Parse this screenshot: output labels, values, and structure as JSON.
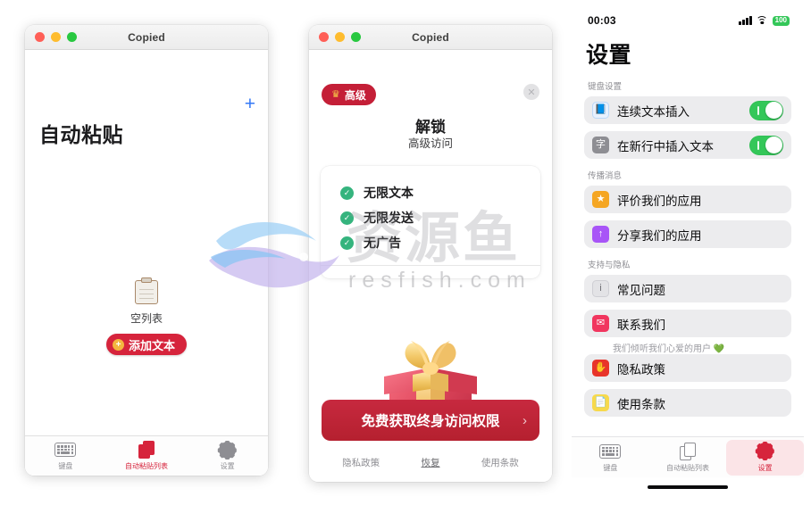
{
  "panel1": {
    "window_title": "Copied",
    "add_icon": "plus-icon",
    "heading": "自动粘贴",
    "empty_label": "空列表",
    "add_button": "添加文本",
    "tabs": [
      {
        "label": "键盘",
        "icon": "keyboard-icon",
        "active": false
      },
      {
        "label": "自动粘贴列表",
        "icon": "documents-icon",
        "active": true
      },
      {
        "label": "设置",
        "icon": "gear-icon",
        "active": false
      }
    ]
  },
  "panel2": {
    "window_title": "Copied",
    "pro_badge": "高级",
    "crown_icon": "crown-icon",
    "close_icon": "close-icon",
    "title": "解锁",
    "subtitle": "高级访问",
    "features": [
      "无限文本",
      "无限发送",
      "无广告"
    ],
    "gift_icon": "gift-box-illustration",
    "cta_label": "免费获取终身访问权限",
    "cta_chevron": "›",
    "footer": [
      {
        "label": "隐私政策",
        "underline": false
      },
      {
        "label": "恢复",
        "underline": true
      },
      {
        "label": "使用条款",
        "underline": false
      }
    ]
  },
  "panel3": {
    "status": {
      "time": "00:03",
      "signal_icon": "cellular-signal-icon",
      "wifi_icon": "wifi-icon",
      "battery": "100"
    },
    "title": "设置",
    "sections": [
      {
        "header": "键盘设置",
        "rows": [
          {
            "label": "连续文本插入",
            "icon": "book-icon",
            "icon_glyph": "📘",
            "icon_class": "ic-blue",
            "toggle": true
          },
          {
            "label": "在新行中插入文本",
            "icon": "text-insert-icon",
            "icon_glyph": "字",
            "icon_class": "ic-gray",
            "toggle": true
          }
        ]
      },
      {
        "header": "传播消息",
        "rows": [
          {
            "label": "评价我们的应用",
            "icon": "star-icon",
            "icon_glyph": "★",
            "icon_class": "ic-orange",
            "toggle": false
          },
          {
            "label": "分享我们的应用",
            "icon": "share-icon",
            "icon_glyph": "↑",
            "icon_class": "ic-purple",
            "toggle": false
          }
        ]
      },
      {
        "header": "支持与隐私",
        "rows": [
          {
            "label": "常见问题",
            "icon": "info-icon",
            "icon_glyph": "i",
            "icon_class": "ic-gray2",
            "toggle": false
          },
          {
            "label": "联系我们",
            "icon": "mail-icon",
            "icon_glyph": "✉",
            "icon_class": "ic-pink",
            "toggle": false,
            "sub": "我们倾听我们心爱的用户 💚"
          },
          {
            "label": "隐私政策",
            "icon": "hand-icon",
            "icon_glyph": "✋",
            "icon_class": "ic-red",
            "toggle": false
          },
          {
            "label": "使用条款",
            "icon": "document-icon",
            "icon_glyph": "📄",
            "icon_class": "ic-yellow",
            "toggle": false
          }
        ]
      }
    ],
    "tabs": [
      {
        "label": "键盘",
        "icon": "keyboard-icon",
        "active": false
      },
      {
        "label": "自动粘贴列表",
        "icon": "documents-icon",
        "active": false
      },
      {
        "label": "设置",
        "icon": "gear-icon",
        "active": true
      }
    ]
  },
  "watermark": {
    "text": "资源鱼",
    "url": "resfish.com",
    "logo_icon": "fish-logo-icon"
  },
  "colors": {
    "accent_red": "#d6243c",
    "cta_red": "#c7293f",
    "toggle_green": "#34c759",
    "check_green": "#35b47e",
    "link_blue": "#3478f6"
  }
}
